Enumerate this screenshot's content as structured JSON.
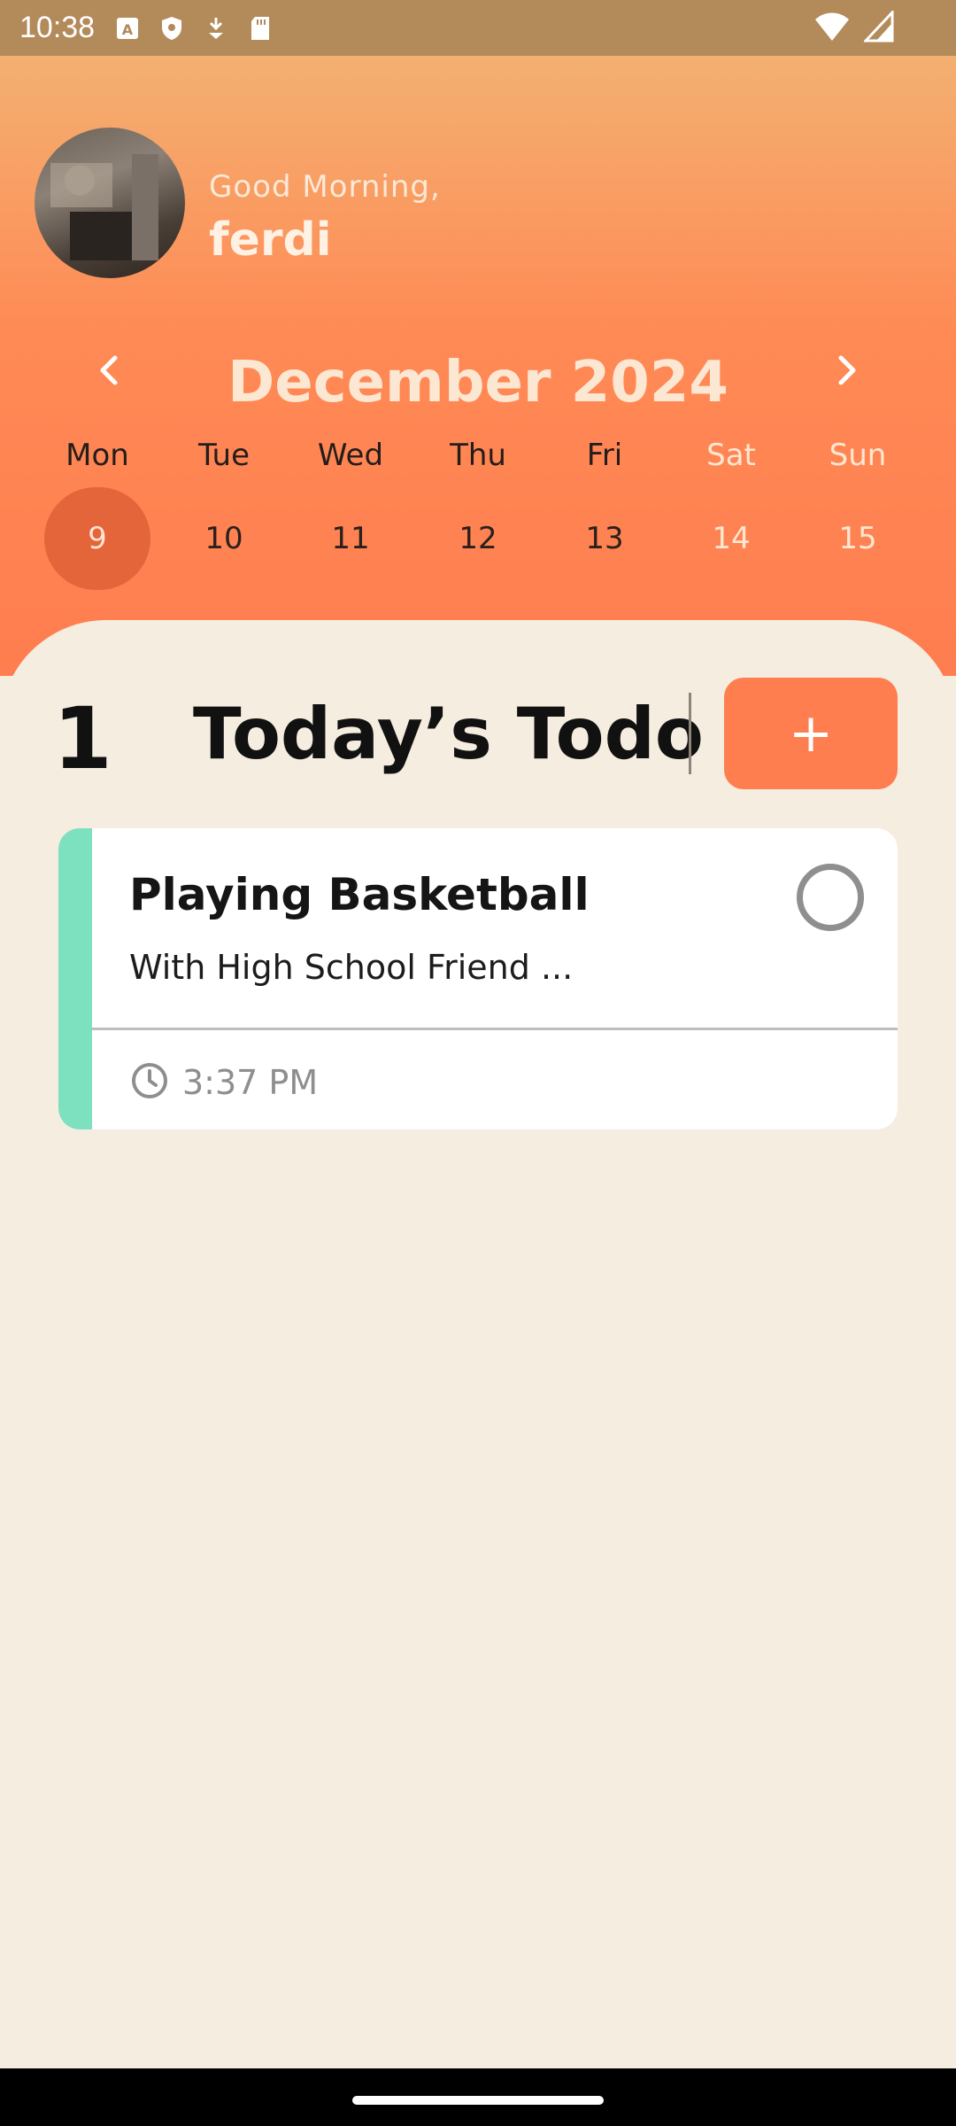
{
  "status_bar": {
    "time": "10:38",
    "icons": [
      "a-icon",
      "shield-icon",
      "download-icon",
      "sd-card-icon"
    ],
    "right_icons": [
      "wifi-icon",
      "signal-icon"
    ]
  },
  "header": {
    "greeting": "Good Morning,",
    "username": "ferdi",
    "month_title": "December 2024"
  },
  "calendar": {
    "days": [
      {
        "name": "Mon",
        "num": "9",
        "selected": true,
        "weekend": false
      },
      {
        "name": "Tue",
        "num": "10",
        "selected": false,
        "weekend": false
      },
      {
        "name": "Wed",
        "num": "11",
        "selected": false,
        "weekend": false
      },
      {
        "name": "Thu",
        "num": "12",
        "selected": false,
        "weekend": false
      },
      {
        "name": "Fri",
        "num": "13",
        "selected": false,
        "weekend": false
      },
      {
        "name": "Sat",
        "num": "14",
        "selected": false,
        "weekend": true
      },
      {
        "name": "Sun",
        "num": "15",
        "selected": false,
        "weekend": true
      }
    ]
  },
  "todo": {
    "count": "1",
    "title": "Today’s Todo",
    "add_label": "+",
    "items": [
      {
        "title": "Playing Basketball",
        "subtitle": "With High School Friend ...",
        "time": "3:37 PM",
        "accent_color": "#7DE0BF"
      }
    ]
  },
  "colors": {
    "accent": "#FF7E50",
    "selected_day": "#E4653A",
    "background": "#F5EDDF"
  }
}
